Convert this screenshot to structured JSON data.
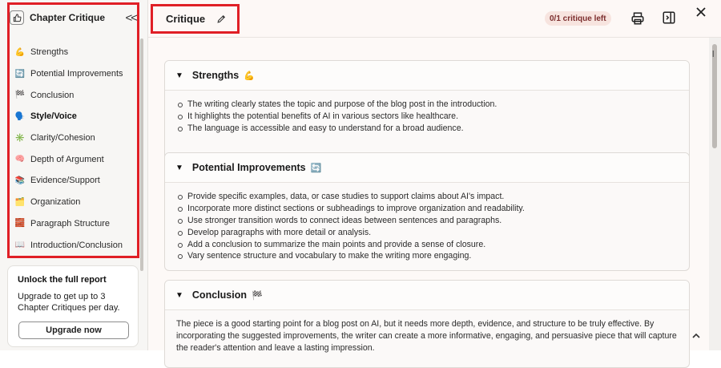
{
  "sidebar": {
    "title": "Chapter Critique",
    "thumb_icon": "thumbs-up-icon",
    "collapse_label": "<<",
    "items": [
      {
        "emoji": "💪",
        "label": "Strengths"
      },
      {
        "emoji": "🔄",
        "label": "Potential Improvements"
      },
      {
        "emoji": "🏁",
        "label": "Conclusion"
      },
      {
        "emoji": "🗣️",
        "label": "Style/Voice",
        "active": true
      },
      {
        "emoji": "✳️",
        "label": "Clarity/Cohesion"
      },
      {
        "emoji": "🧠",
        "label": "Depth of Argument"
      },
      {
        "emoji": "📚",
        "label": "Evidence/Support"
      },
      {
        "emoji": "🗂️",
        "label": "Organization"
      },
      {
        "emoji": "🧱",
        "label": "Paragraph Structure"
      },
      {
        "emoji": "📖",
        "label": "Introduction/Conclusion"
      }
    ],
    "upsell": {
      "title": "Unlock the full report",
      "text": "Upgrade to get up to 3 Chapter Critiques per day.",
      "button": "Upgrade now"
    }
  },
  "topbar": {
    "title": "Critique",
    "badge": "0/1 critique left",
    "close_label": "×",
    "accent_color": "#e01f26"
  },
  "sections": [
    {
      "title": "Strengths",
      "emoji": "💪",
      "bullets": [
        "The writing clearly states the topic and purpose of the blog post in the introduction.",
        "It highlights the potential benefits of AI in various sectors like healthcare.",
        "The language is accessible and easy to understand for a broad audience."
      ]
    },
    {
      "title": "Potential Improvements",
      "emoji": "🔄",
      "bullets": [
        "Provide specific examples, data, or case studies to support claims about AI's impact.",
        "Incorporate more distinct sections or subheadings to improve organization and readability.",
        "Use stronger transition words to connect ideas between sentences and paragraphs.",
        "Develop paragraphs with more detail or analysis.",
        "Add a conclusion to summarize the main points and provide a sense of closure.",
        "Vary sentence structure and vocabulary to make the writing more engaging."
      ]
    },
    {
      "title": "Conclusion",
      "emoji": "🏁",
      "paragraph": "The piece is a good starting point for a blog post on AI, but it needs more depth, evidence, and structure to be truly effective. By incorporating the suggested improvements, the writer can create a more informative, engaging, and persuasive piece that will capture the reader's attention and leave a lasting impression."
    }
  ],
  "edge_text": "l"
}
